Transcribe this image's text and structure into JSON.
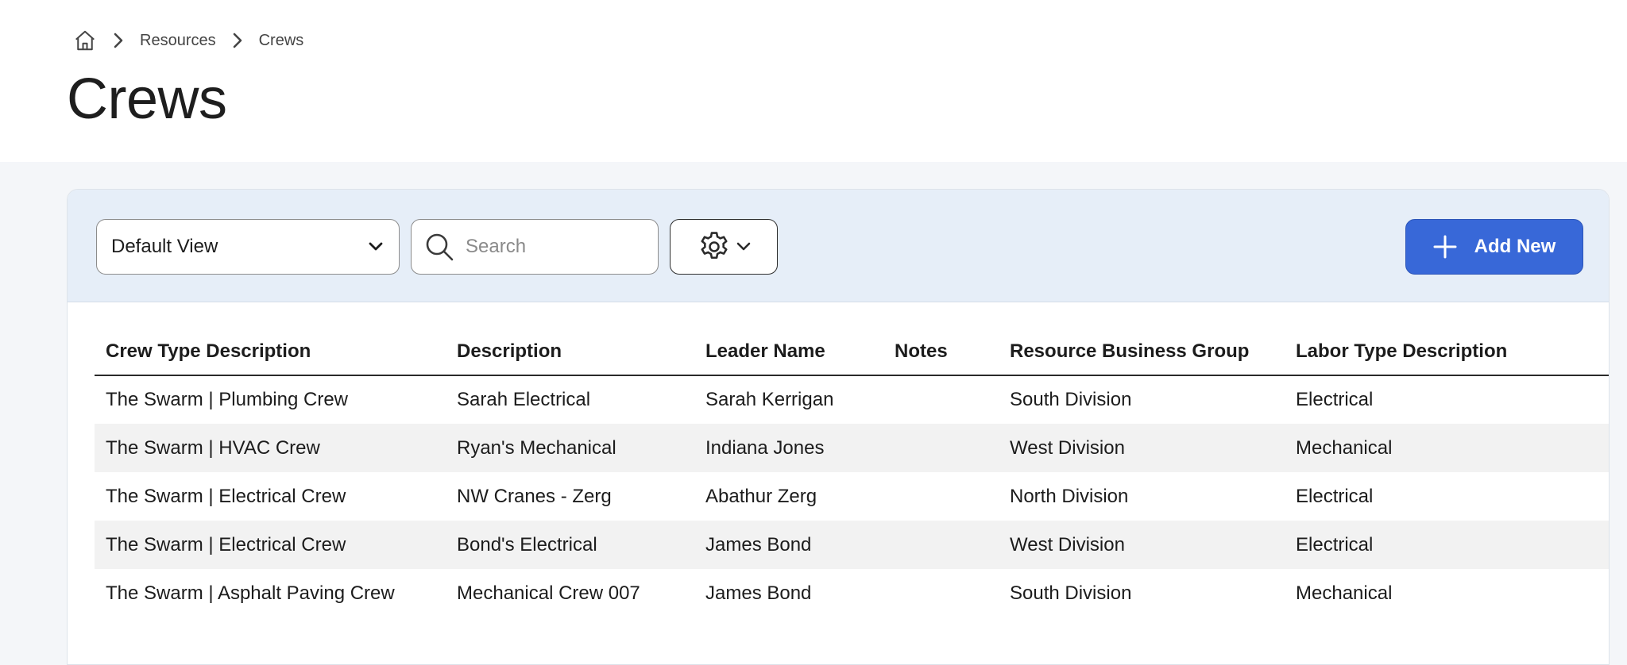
{
  "breadcrumb": {
    "home_icon": "home-icon",
    "items": [
      "Resources",
      "Crews"
    ]
  },
  "page": {
    "title": "Crews"
  },
  "toolbar": {
    "view_select": {
      "value": "Default View",
      "icon": "chevron-down-icon"
    },
    "search": {
      "placeholder": "Search",
      "value": "",
      "icon": "search-icon"
    },
    "settings": {
      "icon": "gear-icon",
      "dropdown_icon": "chevron-down-icon"
    },
    "add_new": {
      "label": "Add New",
      "icon": "plus-icon"
    }
  },
  "table": {
    "columns": [
      "Crew Type Description",
      "Description",
      "Leader Name",
      "Notes",
      "Resource Business Group",
      "Labor Type Description"
    ],
    "rows": [
      [
        "The Swarm | Plumbing Crew",
        "Sarah Electrical",
        "Sarah Kerrigan",
        "",
        "South Division",
        "Electrical"
      ],
      [
        "The Swarm | HVAC Crew",
        "Ryan's Mechanical",
        "Indiana Jones",
        "",
        "West Division",
        "Mechanical"
      ],
      [
        "The Swarm | Electrical Crew",
        "NW Cranes - Zerg",
        "Abathur Zerg",
        "",
        "North Division",
        "Electrical"
      ],
      [
        "The Swarm | Electrical Crew",
        "Bond's Electrical",
        "James Bond",
        "",
        "West Division",
        "Electrical"
      ],
      [
        "The Swarm | Asphalt Paving Crew",
        "Mechanical Crew 007",
        "James Bond",
        "",
        "South Division",
        "Mechanical"
      ]
    ]
  },
  "colors": {
    "primary": "#3868d8",
    "toolbar_bg": "#e6eef8",
    "page_bg": "#f4f6f9",
    "stripe": "#f2f2f2"
  }
}
